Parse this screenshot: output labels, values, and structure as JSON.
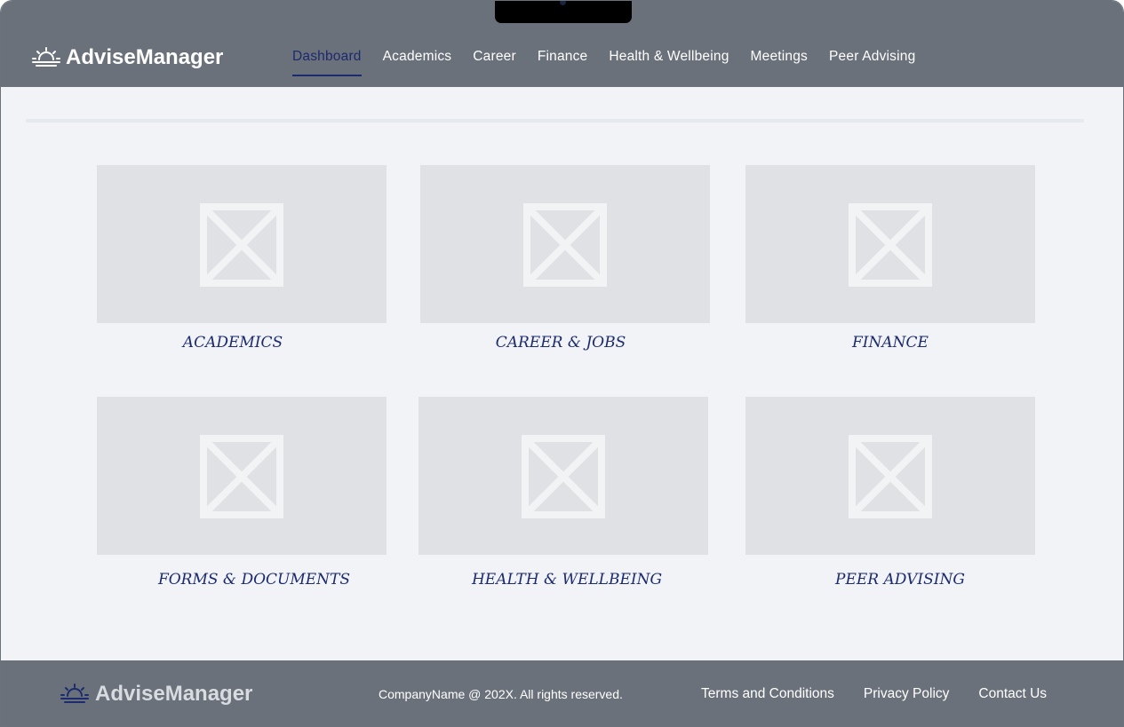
{
  "app": {
    "name": "AdviseManager"
  },
  "nav": {
    "items": [
      {
        "label": "Dashboard",
        "active": true
      },
      {
        "label": "Academics"
      },
      {
        "label": "Career"
      },
      {
        "label": "Finance"
      },
      {
        "label": "Health & Wellbeing"
      },
      {
        "label": "Meetings"
      },
      {
        "label": "Peer Advising"
      }
    ]
  },
  "cards": [
    {
      "label": "ACADEMICS"
    },
    {
      "label": "CAREER & JOBS"
    },
    {
      "label": "FINANCE"
    },
    {
      "label": "FORMS & DOCUMENTS"
    },
    {
      "label": "HEALTH & WELLBEING"
    },
    {
      "label": "PEER ADVISING"
    }
  ],
  "footer": {
    "logo": "AdviseManager",
    "copyright": "CompanyName @ 202X. All rights reserved.",
    "links": [
      {
        "label": "Terms and Conditions"
      },
      {
        "label": "Privacy Policy"
      },
      {
        "label": "Contact Us"
      }
    ]
  },
  "icons": {
    "logo": "sunrise-icon",
    "placeholder": "image-placeholder-icon"
  },
  "colors": {
    "header_bg": "#6a717b",
    "accent": "#1c2a6e",
    "page_bg": "#f1f3f7",
    "thumb_bg": "#dfe1e5"
  }
}
